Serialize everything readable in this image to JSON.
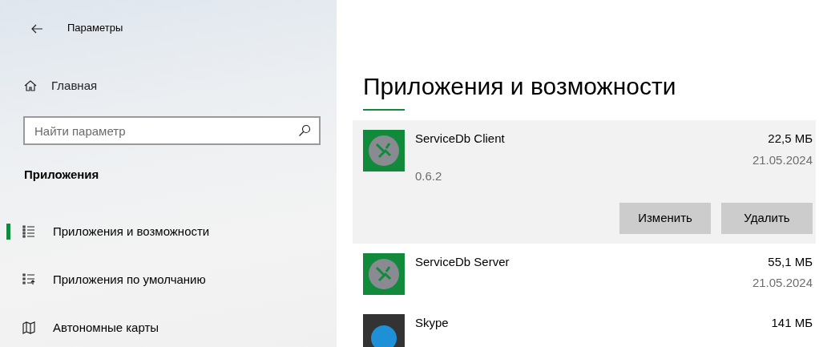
{
  "window": {
    "title": "Параметры"
  },
  "sidebar": {
    "home": "Главная",
    "search": {
      "placeholder": "Найти параметр"
    },
    "section": "Приложения",
    "items": [
      {
        "label": "Приложения и возможности",
        "selected": true
      },
      {
        "label": "Приложения по умолчанию",
        "selected": false
      },
      {
        "label": "Автономные карты",
        "selected": false
      }
    ]
  },
  "page": {
    "heading": "Приложения и возможности",
    "apps": [
      {
        "name": "ServiceDb Client",
        "size": "22,5 МБ",
        "date": "21.05.2024",
        "version": "0.6.2",
        "expanded": true,
        "buttons": [
          "Изменить",
          "Удалить"
        ]
      },
      {
        "name": "ServiceDb Server",
        "size": "55,1 МБ",
        "date": "21.05.2024",
        "expanded": false
      },
      {
        "name": "Skype",
        "size": "141 МБ",
        "expanded": false
      }
    ]
  }
}
